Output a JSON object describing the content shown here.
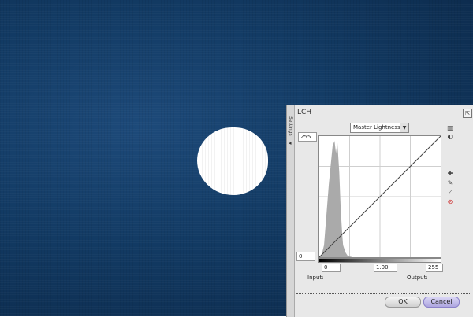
{
  "panel": {
    "title": "LCH",
    "side_tab_label": "Settings",
    "pin_glyph": "⇱",
    "channel": {
      "selected": "Master Lightness",
      "arrow": "▼"
    },
    "graph": {
      "max_value": "255",
      "min_value": "0",
      "input_value": "0",
      "gamma_value": "1.00",
      "output_value": "255",
      "input_label": "Input:",
      "output_label": "Output:"
    },
    "tools": [
      {
        "name": "histogram-icon",
        "glyph": "▥"
      },
      {
        "name": "contrast-icon",
        "glyph": "◐"
      },
      {
        "name": "add-point-icon",
        "glyph": "✚"
      },
      {
        "name": "curve-pencil-icon",
        "glyph": "✎"
      },
      {
        "name": "line-icon",
        "glyph": "⟋"
      },
      {
        "name": "reset-icon",
        "glyph": "⊘"
      }
    ],
    "buttons": {
      "ok": "OK",
      "cancel": "Cancel"
    }
  },
  "chart_data": {
    "type": "area",
    "x": [
      0,
      5,
      10,
      15,
      20,
      25,
      28,
      32,
      35,
      38,
      42,
      45,
      48,
      50,
      55,
      60,
      70,
      80,
      100,
      150,
      200,
      255
    ],
    "values": [
      0,
      2,
      10,
      35,
      60,
      80,
      92,
      96,
      86,
      95,
      70,
      40,
      20,
      10,
      4,
      1,
      0,
      0,
      0,
      0,
      0,
      0
    ],
    "curve": [
      [
        0,
        0
      ],
      [
        255,
        255
      ]
    ],
    "xlim": [
      0,
      255
    ],
    "ylim": [
      0,
      100
    ],
    "grid": true
  }
}
